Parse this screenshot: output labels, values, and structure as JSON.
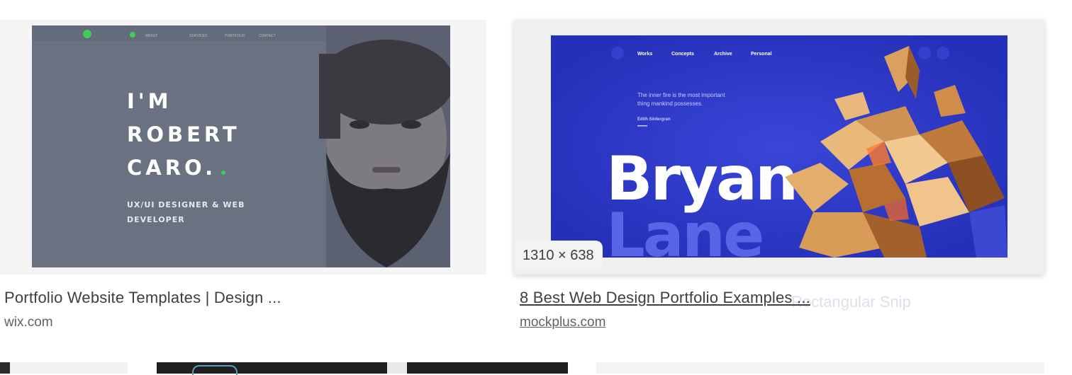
{
  "results": [
    {
      "title": "Portfolio Website Templates | Design ...",
      "source": "wix.com",
      "image": {
        "nav_items": [
          "ABOUT",
          "SERVICES",
          "PORTFOLIO",
          "CONTACT"
        ],
        "headline_line1": "I'M",
        "headline_line2": "ROBERT",
        "headline_line3": "CARO.",
        "subtitle_line1": "UX/UI DESIGNER & WEB",
        "subtitle_line2": "DEVELOPER"
      }
    },
    {
      "title": "8 Best Web Design Portfolio Examples ...",
      "source": "mockplus.com",
      "dimensions": "1310 × 638",
      "image": {
        "nav_items": [
          "Works",
          "Concepts",
          "Archive",
          "Personal"
        ],
        "quote_line1": "The inner fire is the most important",
        "quote_line2": "thing mankind possesses.",
        "quote_author": "Edith Södergran",
        "name_line1": "Bryan",
        "name_line2": "Lane"
      }
    }
  ],
  "overlay": {
    "snip_label": "Rectangular Snip"
  },
  "colors": {
    "accent_green": "#3ecf5a",
    "bryan_blue": "#2a35c4",
    "wix_gray": "#6b7280"
  }
}
